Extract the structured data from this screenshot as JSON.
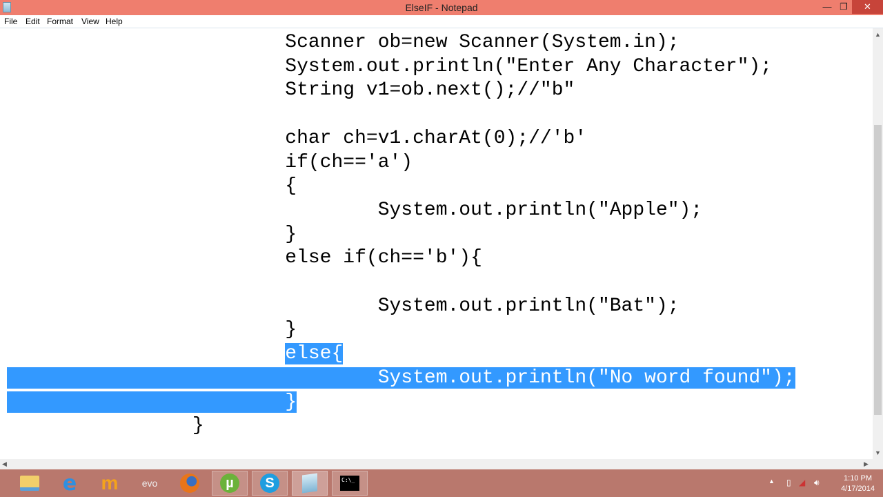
{
  "window": {
    "title": "ElseIF - Notepad",
    "minimize": "—",
    "maximize": "❐",
    "close": "✕"
  },
  "menu": [
    "File",
    "Edit",
    "Format",
    "View",
    "Help"
  ],
  "code": [
    {
      "pre": "                        Scanner ob=new Scanner(System.in);",
      "sel": ""
    },
    {
      "pre": "                        System.out.println(\"Enter Any Character\");",
      "sel": ""
    },
    {
      "pre": "                        String v1=ob.next();//\"b\"",
      "sel": ""
    },
    {
      "pre": "",
      "sel": ""
    },
    {
      "pre": "                        char ch=v1.charAt(0);//'b'",
      "sel": ""
    },
    {
      "pre": "                        if(ch=='a')",
      "sel": ""
    },
    {
      "pre": "                        {",
      "sel": ""
    },
    {
      "pre": "                                System.out.println(\"Apple\");",
      "sel": ""
    },
    {
      "pre": "                        }",
      "sel": ""
    },
    {
      "pre": "                        else if(ch=='b'){",
      "sel": ""
    },
    {
      "pre": "",
      "sel": ""
    },
    {
      "pre": "                                System.out.println(\"Bat\");",
      "sel": ""
    },
    {
      "pre": "                        }",
      "sel": ""
    },
    {
      "pre": "                        ",
      "sel": "else{"
    },
    {
      "pre": "",
      "sel": "                                System.out.println(\"No word found\");"
    },
    {
      "pre": "",
      "sel": "                        }"
    },
    {
      "pre": "                ",
      "sel": ""
    },
    {
      "pre": "                }",
      "sel": ""
    }
  ],
  "taskbar": {
    "apps": [
      "file-explorer",
      "internet-explorer",
      "app-m",
      "evo",
      "firefox",
      "utorrent",
      "skype",
      "notepad",
      "command-prompt"
    ],
    "evo_label": "evo",
    "cmd_label": "C:\\_",
    "time": "1:10 PM",
    "date": "4/17/2014"
  }
}
